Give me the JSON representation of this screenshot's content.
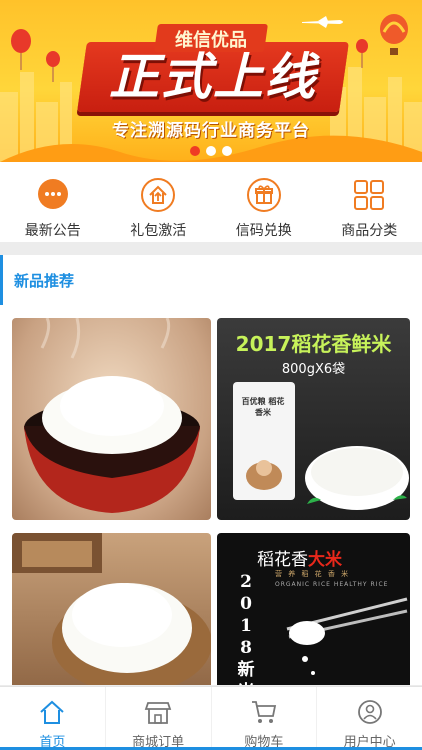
{
  "banner": {
    "tag": "维信优品",
    "headline": "正式上线",
    "subtitle": "专注溯源码行业商务平台",
    "slides": 3,
    "active_slide": 0
  },
  "quicknav": [
    {
      "label": "最新公告",
      "icon": "chat-bubble-icon"
    },
    {
      "label": "礼包激活",
      "icon": "upload-house-icon"
    },
    {
      "label": "信码兑换",
      "icon": "gift-icon"
    },
    {
      "label": "商品分类",
      "icon": "grid-icon"
    }
  ],
  "section": {
    "title": "新品推荐"
  },
  "products": {
    "p2_title": "2017稻花香鲜米",
    "p2_sub": "800gX6袋",
    "p2_bag_label": "百优粮 稻花香米",
    "p4_title_a": "稻花香",
    "p4_title_b": "大米",
    "p4_year": [
      "2",
      "0",
      "1",
      "8",
      "新",
      "米"
    ],
    "p4_small": "营 养 稻 花 香 米",
    "p4_small2": "ORGANIC RICE HEALTHY RICE"
  },
  "tabbar": [
    {
      "label": "首页",
      "icon": "home-icon",
      "active": true
    },
    {
      "label": "商城订单",
      "icon": "shop-icon",
      "active": false
    },
    {
      "label": "购物车",
      "icon": "cart-icon",
      "active": false
    },
    {
      "label": "用户中心",
      "icon": "user-icon",
      "active": false
    }
  ],
  "colors": {
    "accent": "#1e8fe1",
    "icon_orange": "#f07c22",
    "banner_red": "#d9281a"
  }
}
